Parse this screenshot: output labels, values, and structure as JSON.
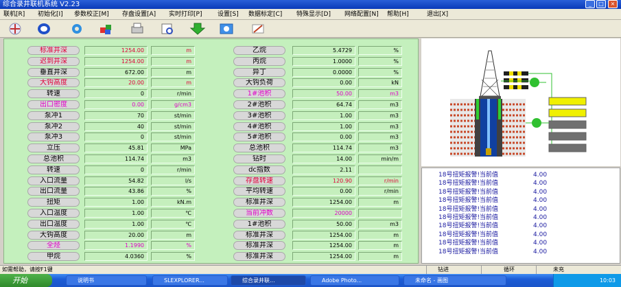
{
  "window": {
    "title": "综合录井联机系统 V2.23",
    "min": "_",
    "max": "□",
    "close": "×"
  },
  "menu": [
    "联机[R]",
    "初始化[I]",
    "参数校正[M]",
    "存盘设置[A]",
    "实时打印[P]",
    "设置[S]",
    "数据标定[C]",
    "特殊显示[D]",
    "网络配置[N]",
    "帮助[H]",
    "退出[X]"
  ],
  "toolbar": {
    "icons": [
      "connect-icon",
      "globe-icon",
      "gear-icon",
      "cubes-icon",
      "print-icon",
      "print-preview-icon",
      "download-arrow-icon",
      "screen-icon",
      "edit-icon"
    ]
  },
  "left_rows": [
    {
      "label": "标准井深",
      "value": "1254.00",
      "unit": "m",
      "label_color": "red",
      "value_color": "red",
      "unit_color": "red"
    },
    {
      "label": "迟到井深",
      "value": "1254.00",
      "unit": "m",
      "label_color": "red",
      "value_color": "red",
      "unit_color": "red"
    },
    {
      "label": "垂直井深",
      "value": "672.00",
      "unit": "m"
    },
    {
      "label": "大钩高度",
      "value": "20.00",
      "unit": "m",
      "label_color": "red",
      "value_color": "red",
      "unit_color": "red"
    },
    {
      "label": "转速",
      "value": "0",
      "unit": "r/min"
    },
    {
      "label": "出口密度",
      "value": "0.00",
      "unit": "g/cm3",
      "label_color": "mag",
      "value_color": "mag",
      "unit_color": "mag"
    },
    {
      "label": "泵冲1",
      "value": "70",
      "unit": "st/min"
    },
    {
      "label": "泵冲2",
      "value": "40",
      "unit": "st/min"
    },
    {
      "label": "泵冲3",
      "value": "0",
      "unit": "st/min"
    },
    {
      "label": "立压",
      "value": "45.81",
      "unit": "MPa"
    },
    {
      "label": "总池积",
      "value": "114.74",
      "unit": "m3"
    },
    {
      "label": "转速",
      "value": "0",
      "unit": "r/min"
    },
    {
      "label": "入口流量",
      "value": "54.82",
      "unit": "l/s"
    },
    {
      "label": "出口流量",
      "value": "43.86",
      "unit": "%"
    },
    {
      "label": "扭矩",
      "value": "1.00",
      "unit": "kN.m"
    },
    {
      "label": "入口温度",
      "value": "1.00",
      "unit": "℃"
    },
    {
      "label": "出口温度",
      "value": "1.00",
      "unit": "℃"
    },
    {
      "label": "大钩高度",
      "value": "20.00",
      "unit": "m"
    },
    {
      "label": "全烃",
      "value": "1.1990",
      "unit": "%",
      "label_color": "mag",
      "value_color": "mag",
      "unit_color": "mag"
    },
    {
      "label": "甲烷",
      "value": "4.0360",
      "unit": "%"
    }
  ],
  "right_rows": [
    {
      "label": "乙烷",
      "value": "5.4729",
      "unit": "%"
    },
    {
      "label": "丙烷",
      "value": "1.0000",
      "unit": "%"
    },
    {
      "label": "异丁",
      "value": "0.0000",
      "unit": "%"
    },
    {
      "label": "大钩负荷",
      "value": "0.00",
      "unit": "kN"
    },
    {
      "label": "1#池积",
      "value": "50.00",
      "unit": "m3",
      "label_color": "mag",
      "value_color": "mag",
      "unit_color": "mag"
    },
    {
      "label": "2#池积",
      "value": "64.74",
      "unit": "m3"
    },
    {
      "label": "3#池积",
      "value": "1.00",
      "unit": "m3"
    },
    {
      "label": "4#池积",
      "value": "1.00",
      "unit": "m3"
    },
    {
      "label": "5#池积",
      "value": "0.00",
      "unit": "m3"
    },
    {
      "label": "总池积",
      "value": "114.74",
      "unit": "m3"
    },
    {
      "label": "钻时",
      "value": "14.00",
      "unit": "min/m"
    },
    {
      "label": "dc指数",
      "value": "2.11",
      "unit": ""
    },
    {
      "label": "存盘转速",
      "value": "120.90",
      "unit": "r/min",
      "label_color": "red",
      "value_color": "red",
      "unit_color": "red"
    },
    {
      "label": "平均转速",
      "value": "0.00",
      "unit": "r/min"
    },
    {
      "label": "标准井深",
      "value": "1254.00",
      "unit": "m"
    },
    {
      "label": "当前冲数",
      "value": "20000",
      "unit": "",
      "label_color": "mag",
      "value_color": "mag"
    },
    {
      "label": "1#池积",
      "value": "50.00",
      "unit": "m3"
    },
    {
      "label": "标准井深",
      "value": "1254.00",
      "unit": "m"
    },
    {
      "label": "标准井深",
      "value": "1254.00",
      "unit": "m"
    },
    {
      "label": "标准井深",
      "value": "1254.00",
      "unit": "m"
    }
  ],
  "alarms": [
    {
      "text": "18号扭矩报警!当前值",
      "value": "4.00"
    },
    {
      "text": "18号扭矩报警!当前值",
      "value": "4.00"
    },
    {
      "text": "18号扭矩报警!当前值",
      "value": "4.00"
    },
    {
      "text": "18号扭矩报警!当前值",
      "value": "4.00"
    },
    {
      "text": "18号扭矩报警!当前值",
      "value": "4.00"
    },
    {
      "text": "18号扭矩报警!当前值",
      "value": "4.00"
    },
    {
      "text": "18号扭矩报警!当前值",
      "value": "4.00"
    },
    {
      "text": "18号扭矩报警!当前值",
      "value": "4.00"
    },
    {
      "text": "18号扭矩报警!当前值",
      "value": "4.00"
    },
    {
      "text": "18号扭矩报警!当前值",
      "value": "4.00"
    }
  ],
  "status": {
    "help": "如需帮助，请按F1键",
    "mode": "钻进",
    "circ": "循环",
    "rot": "未充"
  },
  "taskbar": {
    "start": "开始",
    "tasks": [
      "说明书",
      "SLEXPLORER...",
      "综合录井联...",
      "Adobe Photo...",
      "未命名 - 画图"
    ],
    "clock": "10:03"
  },
  "colors": {
    "panel": "#c4f0bd",
    "red": "#e0003a",
    "magenta": "#e000c8",
    "alarm_text": "#1a1aa0"
  }
}
